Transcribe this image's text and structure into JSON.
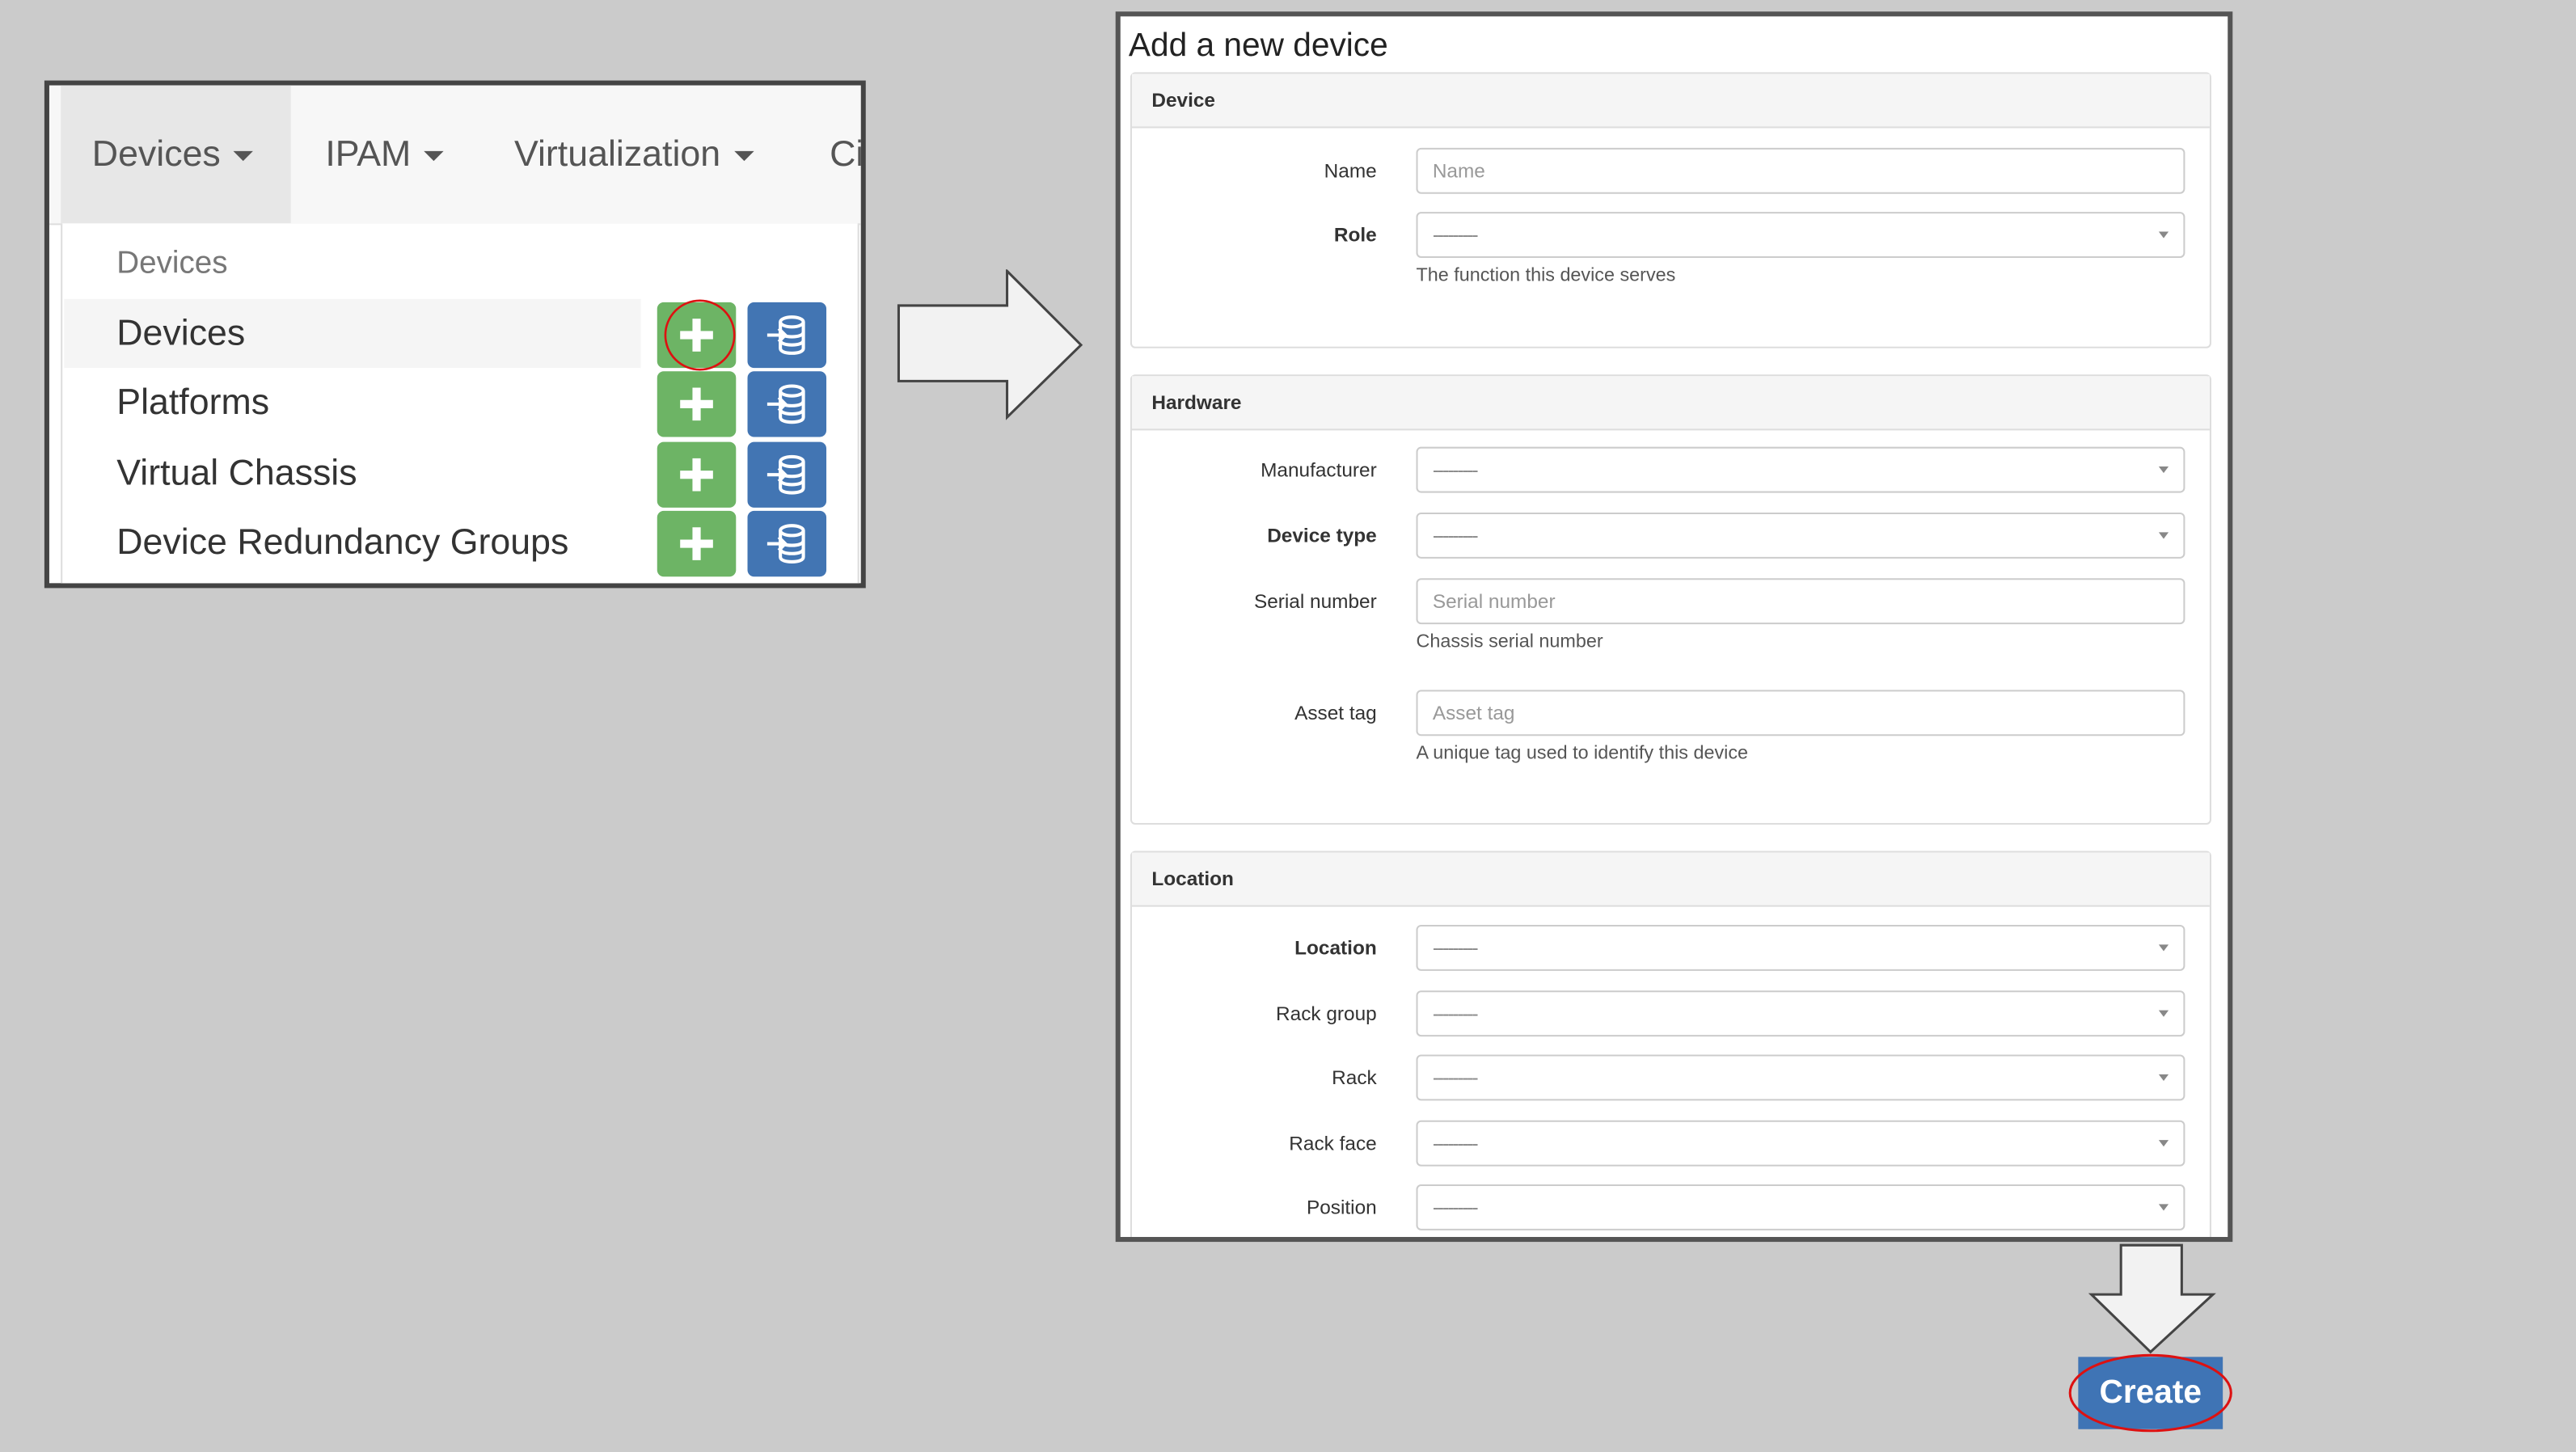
{
  "menu_panel": {
    "nav_tabs": [
      {
        "label": "Devices",
        "active": true
      },
      {
        "label": "IPAM"
      },
      {
        "label": "Virtualization"
      },
      {
        "label": "Ci"
      }
    ],
    "dropdown_header": "Devices",
    "items": [
      {
        "label": "Devices",
        "highlighted": true,
        "add_icon": "plus-icon",
        "import_icon": "import-database-icon"
      },
      {
        "label": "Platforms",
        "add_icon": "plus-icon",
        "import_icon": "import-database-icon"
      },
      {
        "label": "Virtual Chassis",
        "add_icon": "plus-icon",
        "import_icon": "import-database-icon"
      },
      {
        "label": "Device Redundancy Groups",
        "add_icon": "plus-icon",
        "import_icon": "import-database-icon"
      }
    ]
  },
  "form": {
    "title": "Add a new device",
    "sections": [
      {
        "header": "Device",
        "fields": [
          {
            "label": "Name",
            "type": "text",
            "placeholder": "Name",
            "required": false
          },
          {
            "label": "Role",
            "type": "select",
            "value": "---------",
            "required": true,
            "help": "The function this device serves"
          }
        ]
      },
      {
        "header": "Hardware",
        "fields": [
          {
            "label": "Manufacturer",
            "type": "select",
            "value": "---------",
            "required": false
          },
          {
            "label": "Device type",
            "type": "select",
            "value": "---------",
            "required": true
          },
          {
            "label": "Serial number",
            "type": "text",
            "placeholder": "Serial number",
            "required": false,
            "help": "Chassis serial number"
          },
          {
            "label": "Asset tag",
            "type": "text",
            "placeholder": "Asset tag",
            "required": false,
            "help": "A unique tag used to identify this device"
          }
        ]
      },
      {
        "header": "Location",
        "fields": [
          {
            "label": "Location",
            "type": "select",
            "value": "---------",
            "required": true
          },
          {
            "label": "Rack group",
            "type": "select",
            "value": "---------",
            "required": false
          },
          {
            "label": "Rack",
            "type": "select",
            "value": "---------",
            "required": false
          },
          {
            "label": "Rack face",
            "type": "select",
            "value": "---------",
            "required": false
          },
          {
            "label": "Position",
            "type": "select",
            "value": "---------",
            "required": false
          }
        ]
      }
    ]
  },
  "create_button": {
    "label": "Create"
  },
  "colors": {
    "add_button": "#6db465",
    "import_button": "#4275b3",
    "create_button": "#3f74b5",
    "highlight_circle": "#dd1111"
  }
}
